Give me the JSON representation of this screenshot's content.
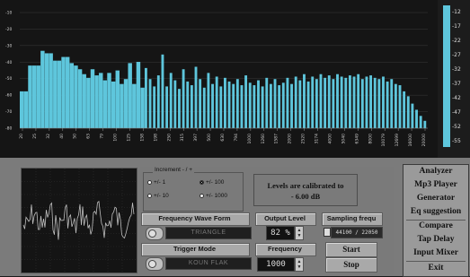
{
  "spectrum": {
    "y_labels": [
      "-10",
      "-20",
      "-30",
      "-40",
      "-50",
      "-60",
      "-70",
      "-80"
    ],
    "x_labels": [
      "20",
      "25",
      "32",
      "40",
      "50",
      "63",
      "79",
      "100",
      "125",
      "158",
      "198",
      "250",
      "315",
      "397",
      "500",
      "630",
      "794",
      "1000",
      "1260",
      "1587",
      "2000",
      "2520",
      "3174",
      "4000",
      "5040",
      "6349",
      "8000",
      "10079",
      "12699",
      "16000",
      "20000"
    ],
    "bar_color": "#5ec6dc",
    "bars": [
      0.3,
      0.3,
      0.51,
      0.51,
      0.51,
      0.63,
      0.61,
      0.61,
      0.55,
      0.55,
      0.58,
      0.58,
      0.53,
      0.51,
      0.48,
      0.44,
      0.41,
      0.48,
      0.43,
      0.45,
      0.39,
      0.45,
      0.38,
      0.47,
      0.36,
      0.4,
      0.53,
      0.36,
      0.54,
      0.33,
      0.49,
      0.4,
      0.34,
      0.43,
      0.6,
      0.34,
      0.45,
      0.39,
      0.32,
      0.48,
      0.38,
      0.35,
      0.5,
      0.4,
      0.33,
      0.45,
      0.36,
      0.42,
      0.34,
      0.41,
      0.38,
      0.36,
      0.4,
      0.35,
      0.43,
      0.37,
      0.35,
      0.39,
      0.34,
      0.41,
      0.36,
      0.4,
      0.35,
      0.37,
      0.41,
      0.36,
      0.42,
      0.39,
      0.44,
      0.38,
      0.42,
      0.4,
      0.44,
      0.41,
      0.43,
      0.4,
      0.44,
      0.42,
      0.41,
      0.43,
      0.42,
      0.44,
      0.4,
      0.42,
      0.43,
      0.41,
      0.4,
      0.42,
      0.38,
      0.4,
      0.36,
      0.35,
      0.3,
      0.26,
      0.2,
      0.15,
      0.1,
      0.06
    ]
  },
  "meter": {
    "labels": [
      "-12",
      "-17",
      "-22",
      "-27",
      "-32",
      "-37",
      "-42",
      "-47",
      "-52",
      "-55"
    ],
    "bar_color": "#5ec6dc"
  },
  "controls": {
    "increment_title": "Increment - / +",
    "increment_options": [
      "+/- 1",
      "+/- 10",
      "+/- 100",
      "+/- 1000"
    ],
    "increment_selected": "+/- 100",
    "calibration_line1": "Levels are calibrated to",
    "calibration_line2": "- 6.00 dB",
    "wave_form_label": "Frequency Wave Form",
    "wave_form_value": "TRIANGLE",
    "output_level_label": "Output Level",
    "output_level_value": "82 %",
    "sampling_label": "Sampling frequ",
    "sampling_value": "44100 / 22050",
    "trigger_label": "Trigger Mode",
    "trigger_value": "KOUN FLAK",
    "frequency_label": "Frequency",
    "frequency_value": "1000",
    "start_label": "Start",
    "stop_label": "Stop"
  },
  "menu": {
    "items": [
      "Analyzer",
      "Mp3 Player",
      "Generator",
      "Eq suggestion",
      "Compare",
      "Tap Delay",
      "Input Mixer",
      "Exit"
    ]
  },
  "scope": {
    "trace_color": "#bfbfbf"
  }
}
